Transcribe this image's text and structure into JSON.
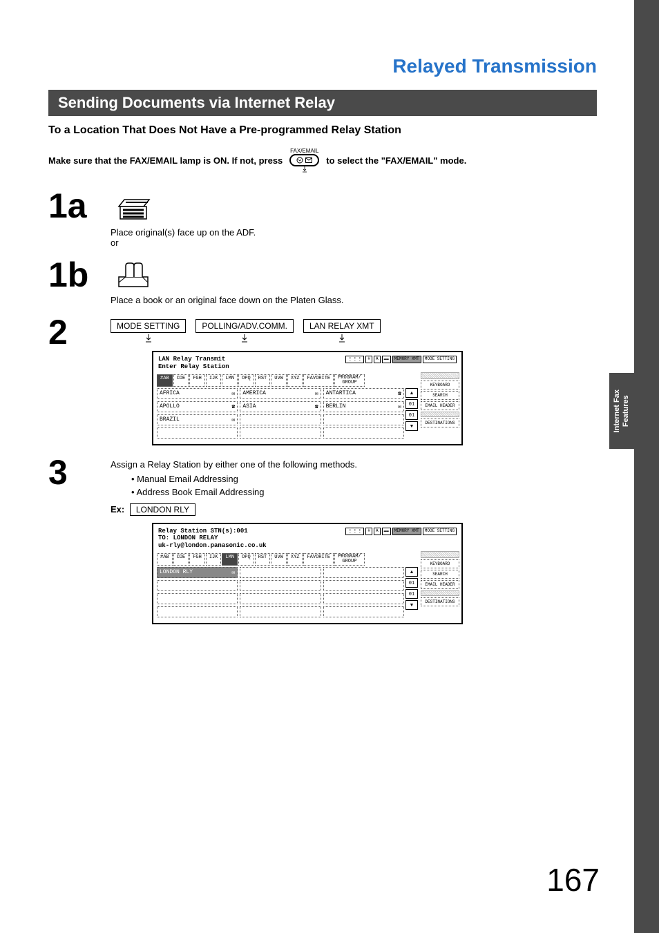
{
  "chapter_title": "Relayed Transmission",
  "section_title": "Sending Documents via Internet Relay",
  "subsection": "To a Location That Does Not Have a Pre-programmed Relay Station",
  "instruction": {
    "part1": "Make sure that the FAX/EMAIL lamp is ON.  If not, press",
    "fax_email_label": "FAX/EMAIL",
    "part2": "to select the \"FAX/EMAIL\" mode."
  },
  "steps": {
    "s1a": {
      "num": "1a",
      "text": "Place original(s) face up on the ADF.",
      "or": "or"
    },
    "s1b": {
      "num": "1b",
      "text": "Place a book or an original face down on the Platen Glass."
    },
    "s2": {
      "num": "2",
      "buttons": [
        "MODE SETTING",
        "POLLING/ADV.COMM.",
        "LAN RELAY XMT"
      ],
      "screen": {
        "line1": "LAN Relay Transmit",
        "line2": "Enter Relay Station",
        "top_btns": [
          "MEMORY XMT",
          "MODE SETTING"
        ],
        "tabs": [
          "#AB",
          "CDE",
          "FGH",
          "IJK",
          "LMN",
          "OPQ",
          "RST",
          "UVW",
          "XYZ",
          "FAVORITE",
          "PROGRAM/\nGROUP"
        ],
        "rows": [
          [
            "AFRICA",
            "AMERICA",
            "ANTARTICA"
          ],
          [
            "APOLLO",
            "ASIA",
            "BERLIN"
          ],
          [
            "BRAZIL",
            "",
            ""
          ],
          [
            "",
            "",
            ""
          ]
        ],
        "row_icons": [
          [
            "mail",
            "mail",
            "phone"
          ],
          [
            "phone",
            "phone",
            "mail"
          ],
          [
            "mail",
            "",
            ""
          ],
          [
            "",
            "",
            ""
          ]
        ],
        "side_panel": [
          "KEYBOARD",
          "SEARCH",
          "EMAIL HEADER",
          "DESTINATIONS"
        ],
        "scroll": [
          "▲",
          "01",
          "01",
          "▼"
        ]
      }
    },
    "s3": {
      "num": "3",
      "text": "Assign a Relay Station by either one of the following methods.",
      "bullets": [
        "• Manual Email Addressing",
        "• Address Book Email Addressing"
      ],
      "ex_label": "Ex:",
      "ex_value": "LONDON RLY",
      "screen": {
        "line1": "Relay Station STN(s):001",
        "line2": "TO: LONDON RELAY",
        "line3": "uk-rly@london.panasonic.co.uk",
        "top_btns": [
          "MEMORY XMT",
          "MODE SETTING"
        ],
        "tabs": [
          "#AB",
          "CDE",
          "FGH",
          "IJK",
          "LMN",
          "OPQ",
          "RST",
          "UVW",
          "XYZ",
          "FAVORITE",
          "PROGRAM/\nGROUP"
        ],
        "rows": [
          [
            "LONDON RLY",
            "",
            ""
          ],
          [
            "",
            "",
            ""
          ],
          [
            "",
            "",
            ""
          ],
          [
            "",
            "",
            ""
          ]
        ],
        "row_icons": [
          [
            "mail",
            "",
            ""
          ],
          [
            "",
            "",
            ""
          ],
          [
            "",
            "",
            ""
          ],
          [
            "",
            "",
            ""
          ]
        ],
        "side_panel": [
          "KEYBOARD",
          "SEARCH",
          "EMAIL HEADER",
          "DESTINATIONS"
        ],
        "scroll": [
          "▲",
          "01",
          "01",
          "▼"
        ]
      }
    }
  },
  "side_tab": "Internet Fax\nFeatures",
  "page_number": "167"
}
